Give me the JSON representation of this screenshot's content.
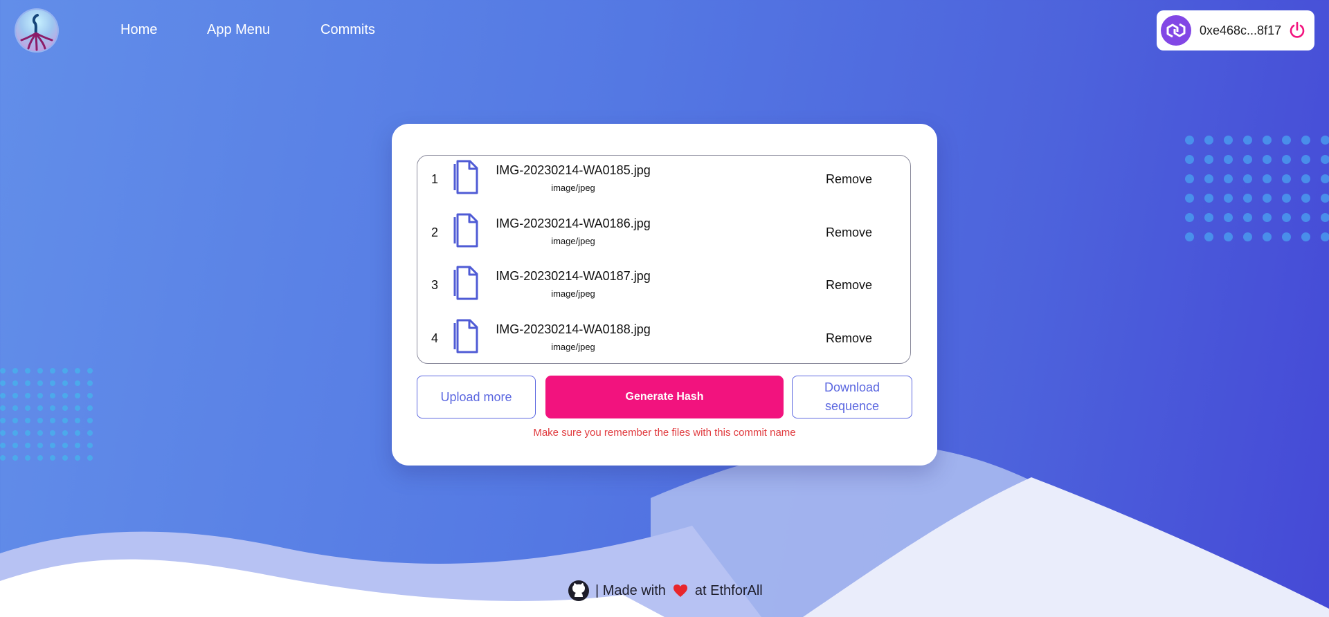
{
  "nav": {
    "logo_icon": "project-logo",
    "links": [
      {
        "label": "Home"
      },
      {
        "label": "App Menu"
      },
      {
        "label": "Commits"
      }
    ]
  },
  "wallet": {
    "network_icon": "polygon-icon",
    "address": "0xe468c...8f17",
    "power_icon": "power-icon"
  },
  "files": [
    {
      "index": "1",
      "name": "IMG-20230214-WA0185.jpg",
      "type": "image/jpeg",
      "action": "Remove"
    },
    {
      "index": "2",
      "name": "IMG-20230214-WA0186.jpg",
      "type": "image/jpeg",
      "action": "Remove"
    },
    {
      "index": "3",
      "name": "IMG-20230214-WA0187.jpg",
      "type": "image/jpeg",
      "action": "Remove"
    },
    {
      "index": "4",
      "name": "IMG-20230214-WA0188.jpg",
      "type": "image/jpeg",
      "action": "Remove"
    }
  ],
  "actions": {
    "upload_more": "Upload more",
    "generate_hash": "Generate Hash",
    "download_sequence": "Download sequence"
  },
  "hint": "Make sure you remember the files with this commit name",
  "footer": {
    "github_icon": "github-icon",
    "made_with": "| Made with",
    "heart_icon": "heart-icon",
    "at_text": "at EthforAll"
  },
  "colors": {
    "accent": "#f2137e",
    "primary": "#5b67e0",
    "warning_text": "#e0393d",
    "wallet_brand": "#8247e5"
  }
}
